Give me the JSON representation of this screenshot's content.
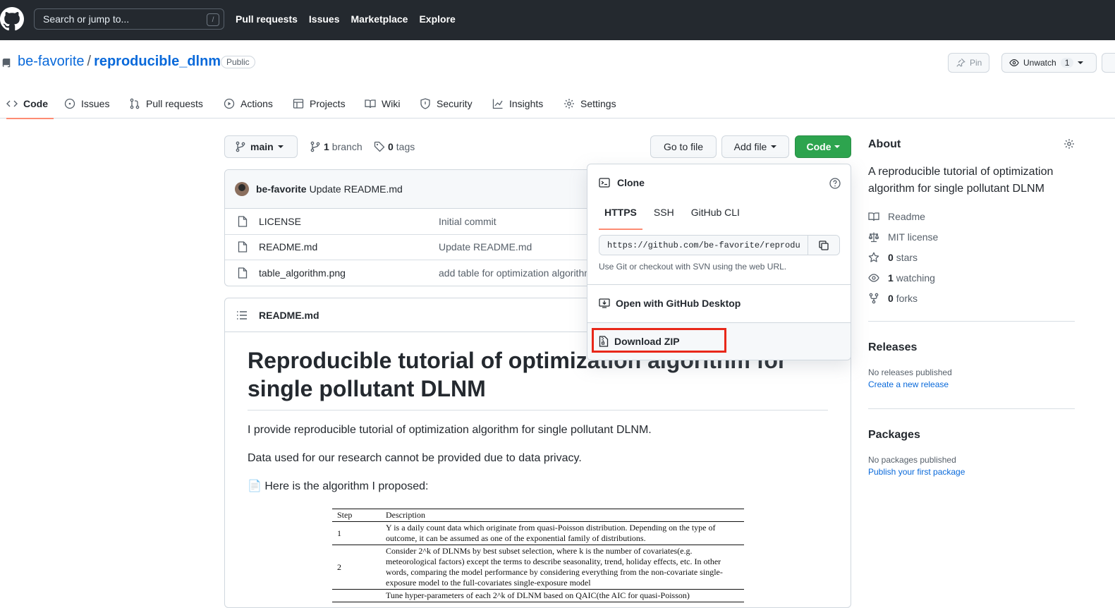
{
  "header": {
    "search_placeholder": "Search or jump to...",
    "search_shortcut": "/",
    "nav": [
      "Pull requests",
      "Issues",
      "Marketplace",
      "Explore"
    ]
  },
  "repo": {
    "owner": "be-favorite",
    "separator": "/",
    "name": "reproducible_dlnm",
    "visibility": "Public",
    "pin_label": "Pin",
    "watch_label": "Unwatch",
    "watch_count": "1"
  },
  "tabs": [
    {
      "label": "Code",
      "icon": "code-icon"
    },
    {
      "label": "Issues",
      "icon": "issue-icon"
    },
    {
      "label": "Pull requests",
      "icon": "pull-request-icon"
    },
    {
      "label": "Actions",
      "icon": "play-icon"
    },
    {
      "label": "Projects",
      "icon": "table-icon"
    },
    {
      "label": "Wiki",
      "icon": "book-icon"
    },
    {
      "label": "Security",
      "icon": "shield-icon"
    },
    {
      "label": "Insights",
      "icon": "graph-icon"
    },
    {
      "label": "Settings",
      "icon": "gear-icon"
    }
  ],
  "toolbar": {
    "branch": "main",
    "branch_count": "1",
    "branch_label": "branch",
    "tag_count": "0",
    "tag_label": "tags",
    "go_to_file": "Go to file",
    "add_file": "Add file",
    "code": "Code"
  },
  "commit": {
    "author": "be-favorite",
    "message": "Update README.md"
  },
  "files": [
    {
      "name": "LICENSE",
      "message": "Initial commit"
    },
    {
      "name": "README.md",
      "message": "Update README.md"
    },
    {
      "name": "table_algorithm.png",
      "message": "add table for optimization algorithm"
    }
  ],
  "readme": {
    "filename": "README.md",
    "title": "Reproducible tutorial of optimization algorithm for single pollutant DLNM",
    "p1": "I provide reproducible tutorial of optimization algorithm for single pollutant DLNM.",
    "p2": "Data used for our research cannot be provided due to data privacy.",
    "p3": "Here is the algorithm I proposed:",
    "p3_icon": "📄",
    "table": {
      "headers": [
        "Step",
        "Description"
      ],
      "rows": [
        {
          "step": "1",
          "desc": "Y is a daily count data which originate from quasi-Poisson distribution. Depending on the type of outcome, it can be assumed as one of the exponential family of distributions."
        },
        {
          "step": "2",
          "desc": "Consider 2^k of DLNMs by best subset selection, where k is the number of covariates(e.g. meteorological factors) except the terms to describe seasonality, trend, holiday effects, etc. In other words, comparing the model performance by considering everything from the non-covariate single-exposure model to the full-covariates single-exposure model"
        },
        {
          "step": "",
          "desc": "Tune hyper-parameters of each 2^k of DLNM based on QAIC(the AIC for quasi-Poisson)"
        }
      ]
    }
  },
  "clone": {
    "title": "Clone",
    "tabs": [
      "HTTPS",
      "SSH",
      "GitHub CLI"
    ],
    "url": "https://github.com/be-favorite/reproducible_dlnm.git",
    "hint": "Use Git or checkout with SVN using the web URL.",
    "desktop": "Open with GitHub Desktop",
    "zip": "Download ZIP"
  },
  "about": {
    "title": "About",
    "description": "A reproducible tutorial of optimization algorithm for single pollutant DLNM",
    "items": [
      {
        "icon": "book-icon",
        "bold": "",
        "text": "Readme"
      },
      {
        "icon": "law-icon",
        "bold": "",
        "text": "MIT license"
      },
      {
        "icon": "star-icon",
        "bold": "0",
        "text": "stars"
      },
      {
        "icon": "eye-icon",
        "bold": "1",
        "text": "watching"
      },
      {
        "icon": "fork-icon",
        "bold": "0",
        "text": "forks"
      }
    ]
  },
  "releases": {
    "title": "Releases",
    "empty": "No releases published",
    "link": "Create a new release"
  },
  "packages": {
    "title": "Packages",
    "empty": "No packages published",
    "link": "Publish your first package"
  },
  "colors": {
    "header_bg": "#24292f",
    "link": "#0969da",
    "primary_green": "#2da44e",
    "tab_underline": "#fd8c73",
    "highlight_red": "#e8281a"
  }
}
